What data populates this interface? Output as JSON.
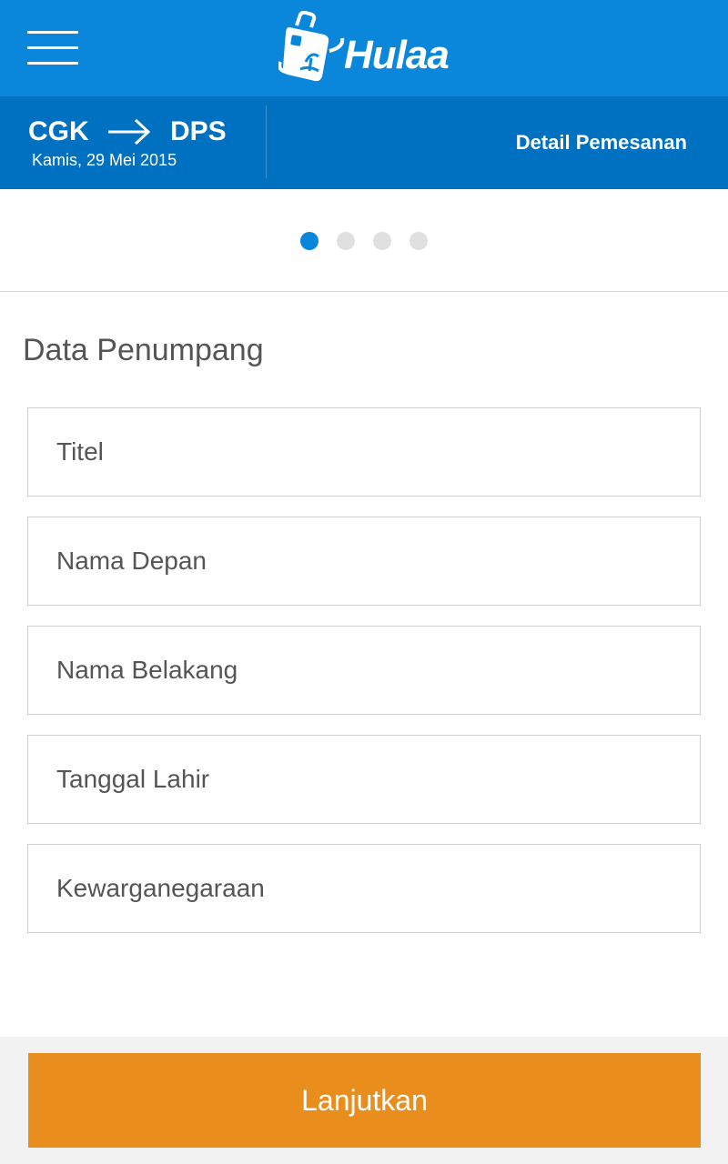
{
  "header": {
    "menu_icon": "hamburger-menu-icon",
    "logo_icon": "suitcase-logo-icon",
    "logo_text": "Hulaa",
    "background": "#0a86da"
  },
  "trip": {
    "origin": "CGK",
    "destination": "DPS",
    "arrow_icon": "arrow-right-icon",
    "date": "Kamis, 29 Mei 2015",
    "detail_link": "Detail Pemesanan",
    "background": "#0071c1"
  },
  "steps": {
    "total": 4,
    "current": 1,
    "active_color": "#0a86da",
    "inactive_color": "#e0e0e0"
  },
  "form": {
    "title": "Data Penumpang",
    "fields": [
      {
        "placeholder": "Titel",
        "value": ""
      },
      {
        "placeholder": "Nama Depan",
        "value": ""
      },
      {
        "placeholder": "Nama Belakang",
        "value": ""
      },
      {
        "placeholder": "Tanggal Lahir",
        "value": ""
      },
      {
        "placeholder": "Kewarganegaraan",
        "value": ""
      }
    ]
  },
  "footer": {
    "continue_label": "Lanjutkan",
    "button_color": "#e98d1c"
  }
}
